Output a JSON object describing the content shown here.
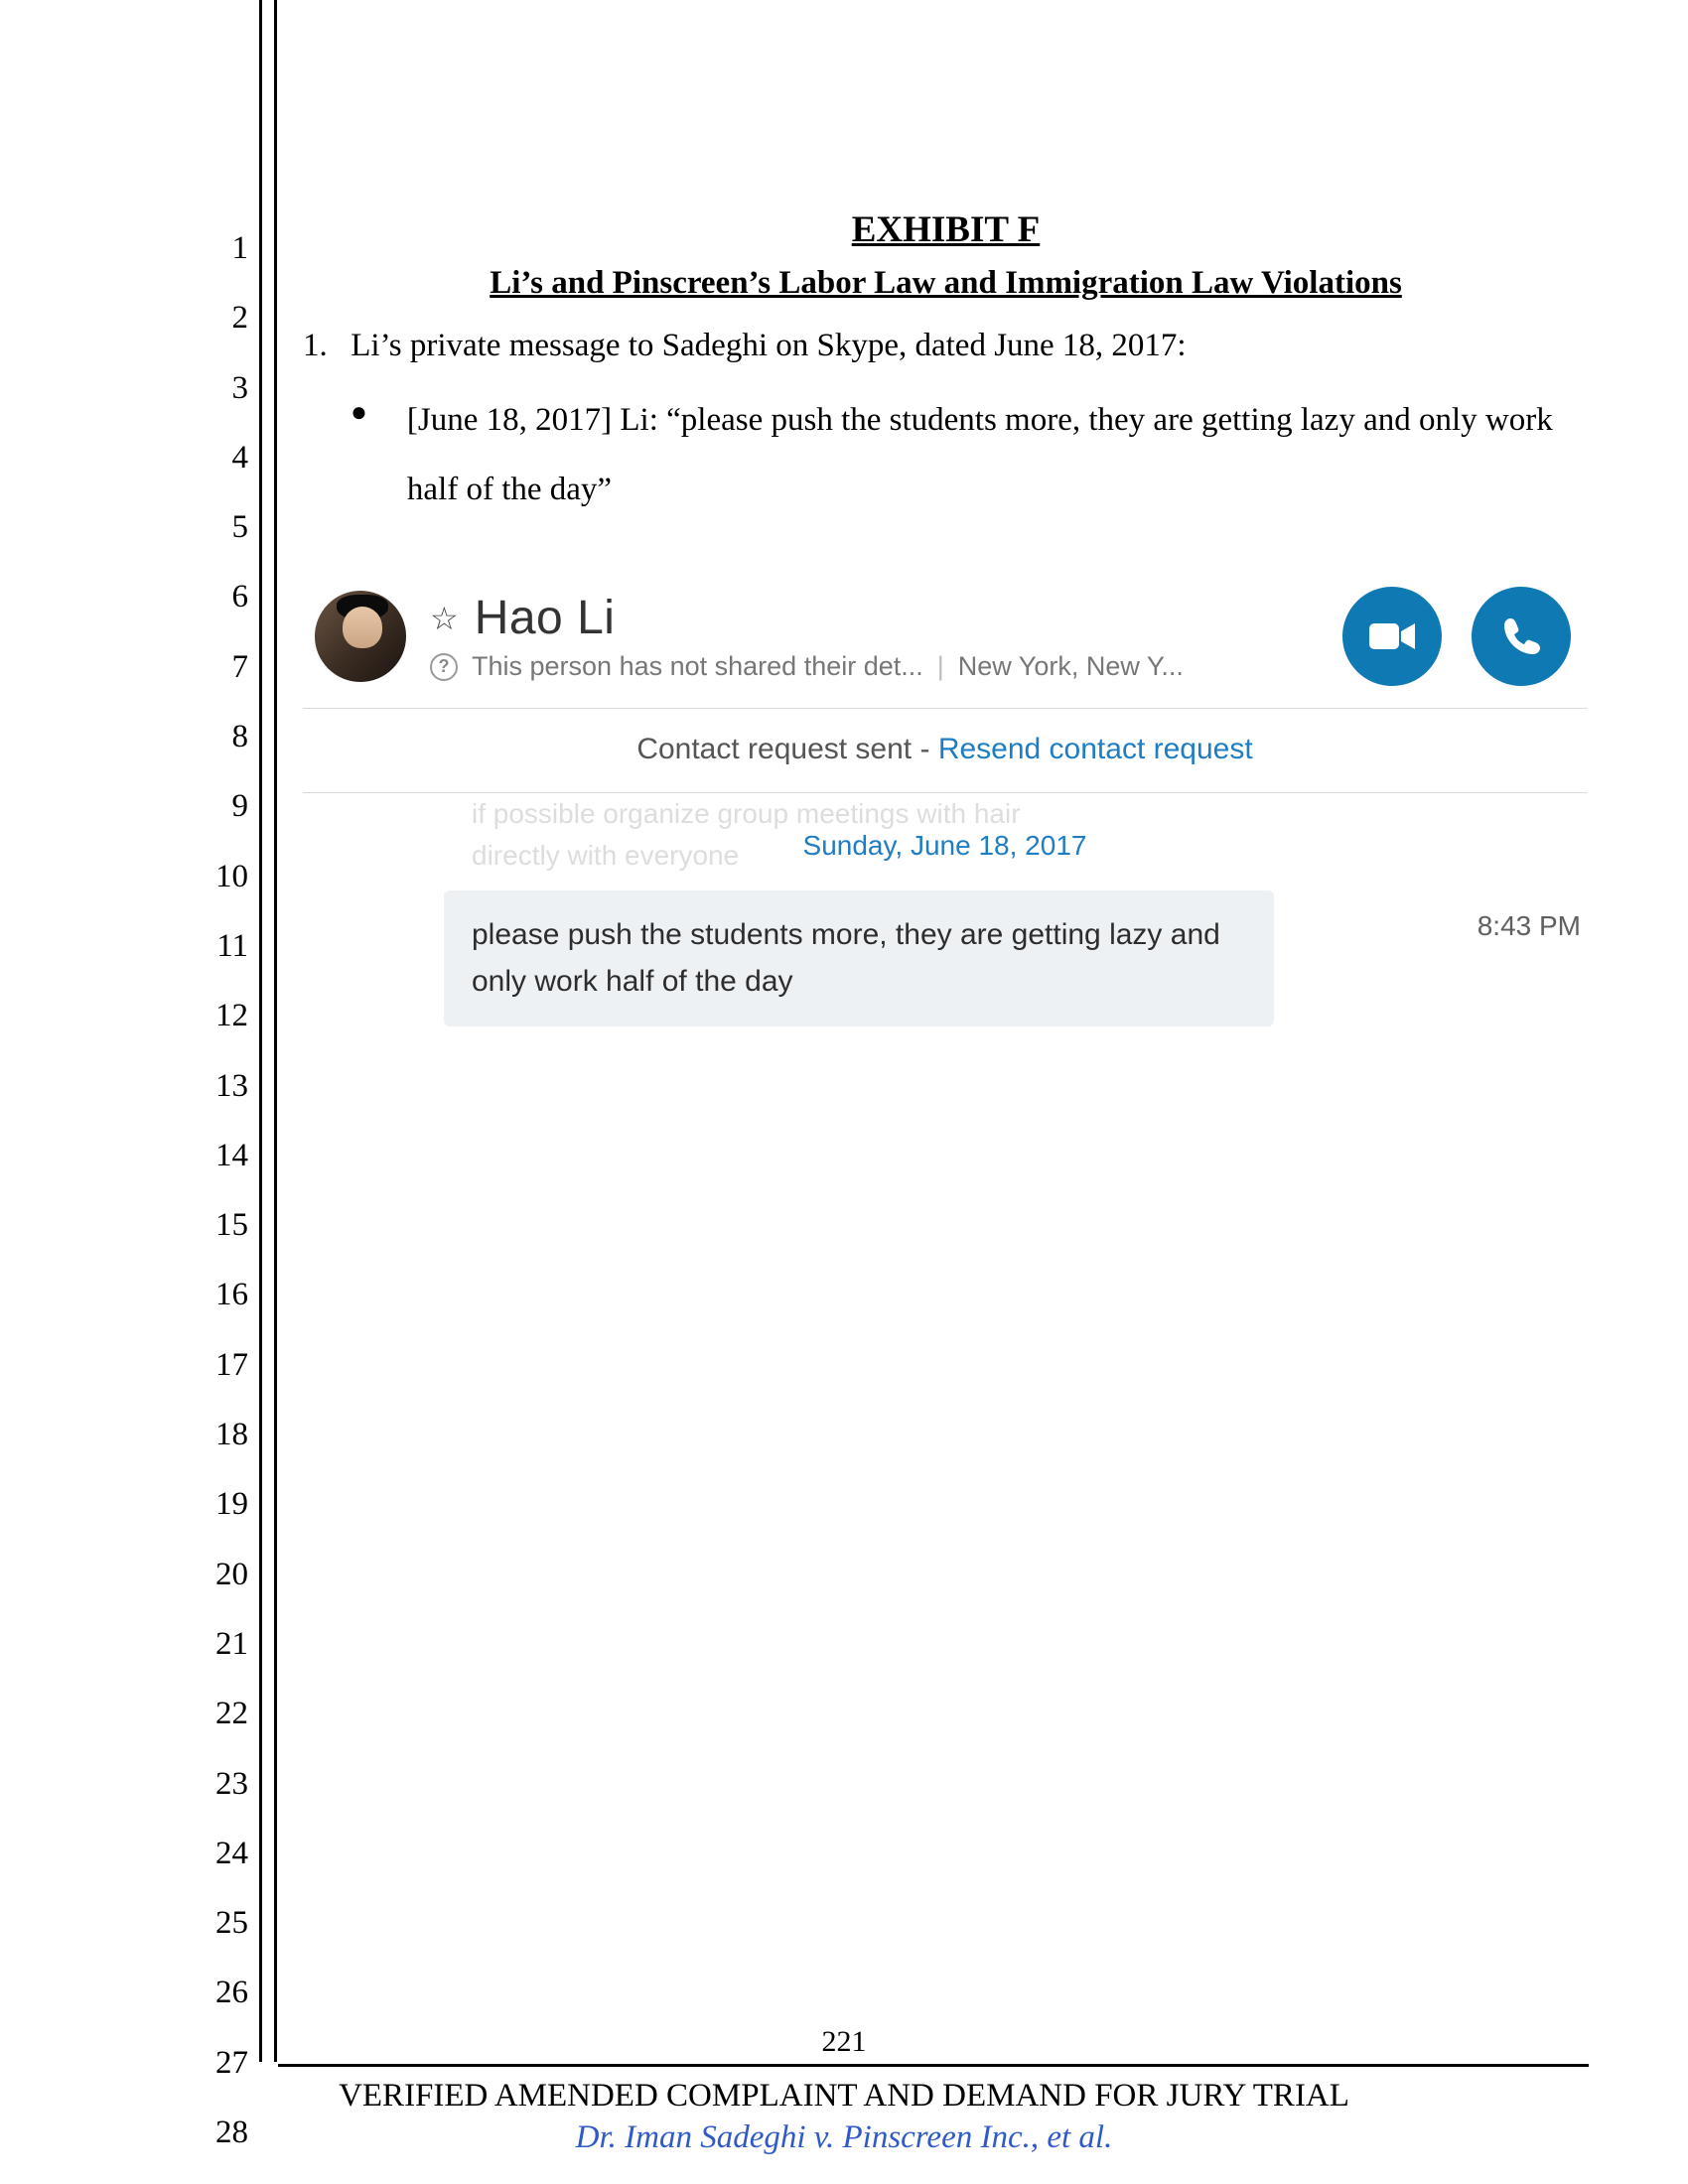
{
  "lineCount": 28,
  "title": "EXHIBIT F",
  "subtitle": "Li’s and Pinscreen’s Labor Law and Immigration Law Violations",
  "para1_num": "1.",
  "para1_text": "Li’s private message to Sadeghi on Skype, dated June 18, 2017:",
  "bullet_text": "[June 18, 2017] Li: “please push the students more, they are getting lazy and only work half of the day”",
  "skype": {
    "contact_name": "Hao Li",
    "detail_text": "This person has not shared their det...",
    "detail_location": "New York, New Y...",
    "contact_request_prefix": "Contact request sent - ",
    "contact_request_link": "Resend contact request",
    "ghost_line1": "if possible organize group meetings with hair",
    "ghost_line2": "directly with everyone",
    "date_separator": "Sunday, June 18, 2017",
    "message_text": "please push the students more, they are getting lazy and only work half of the day",
    "message_time": "8:43 PM"
  },
  "page_number": "221",
  "footer_line1": "VERIFIED AMENDED COMPLAINT AND DEMAND FOR JURY TRIAL",
  "footer_line2": "Dr. Iman Sadeghi v. Pinscreen Inc., et al."
}
